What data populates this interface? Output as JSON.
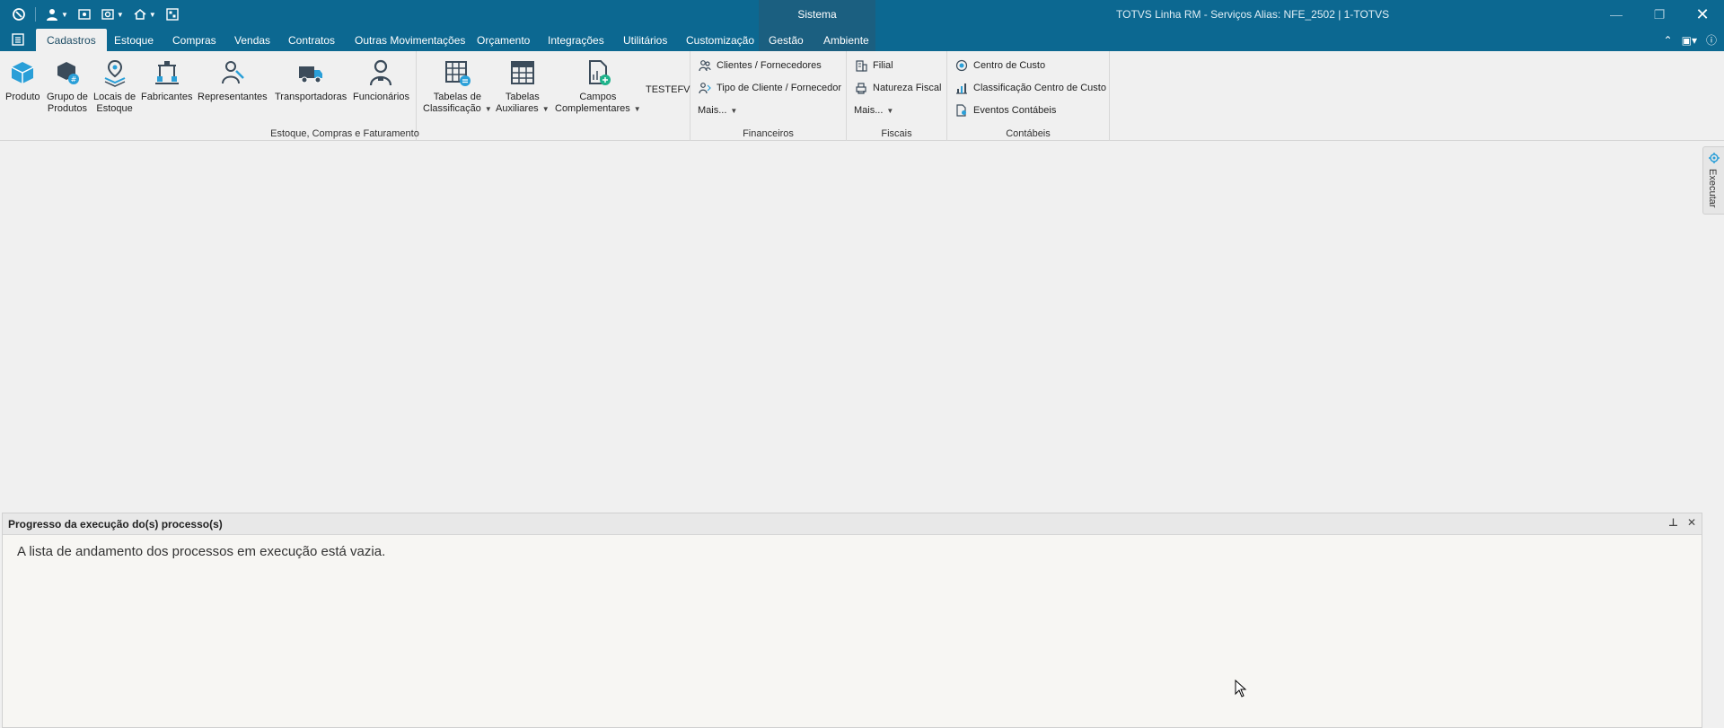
{
  "window": {
    "title": "TOTVS Linha RM - Serviços  Alias: NFE_2502 | 1-TOTVS",
    "context_tab": "Sistema",
    "buttons": {
      "minimize": "—",
      "restore": "❐",
      "close": "✕"
    }
  },
  "tabs": [
    {
      "label": "Cadastros",
      "active": true
    },
    {
      "label": "Estoque"
    },
    {
      "label": "Compras"
    },
    {
      "label": "Vendas"
    },
    {
      "label": "Contratos"
    },
    {
      "label": "Outras Movimentações"
    },
    {
      "label": "Orçamento"
    },
    {
      "label": "Integrações"
    },
    {
      "label": "Utilitários"
    },
    {
      "label": "Customização"
    },
    {
      "label": "Gestão"
    },
    {
      "label": "Ambiente"
    }
  ],
  "ribbon": {
    "estoque_group": {
      "label": "Estoque, Compras e Faturamento",
      "buttons": {
        "produto": "Produto",
        "grupo_produtos_1": "Grupo de",
        "grupo_produtos_2": "Produtos",
        "locais_1": "Locais de",
        "locais_2": "Estoque",
        "fabricantes": "Fabricantes",
        "representantes": "Representantes",
        "transportadoras": "Transportadoras",
        "funcionarios": "Funcionários",
        "tabelas_class_1": "Tabelas de",
        "tabelas_class_2": "Classificação",
        "tabelas_aux_1": "Tabelas",
        "tabelas_aux_2": "Auxiliares",
        "campos_1": "Campos",
        "campos_2": "Complementares",
        "testefv": "TESTEFV"
      }
    },
    "financeiros_group": {
      "label": "Financeiros",
      "clientes": "Clientes / Fornecedores",
      "tipo_cliente": "Tipo de Cliente / Fornecedor",
      "mais": "Mais..."
    },
    "fiscais_group": {
      "label": "Fiscais",
      "filial": "Filial",
      "natureza": "Natureza Fiscal",
      "mais": "Mais..."
    },
    "contabeis_group": {
      "label": "Contábeis",
      "centro_custo": "Centro de Custo",
      "classificacao": "Classificação Centro de Custo",
      "eventos": "Eventos Contábeis"
    }
  },
  "side_panel": {
    "executar": "Executar"
  },
  "progress_panel": {
    "title": "Progresso da execução do(s) processo(s)",
    "empty_message": "A lista de andamento dos processos em execução está vazia.",
    "pin": "⊥",
    "close": "✕"
  },
  "colors": {
    "titlebar": "#0c6891",
    "accent": "#1e88c8",
    "icon_dark": "#3b4b5a"
  }
}
